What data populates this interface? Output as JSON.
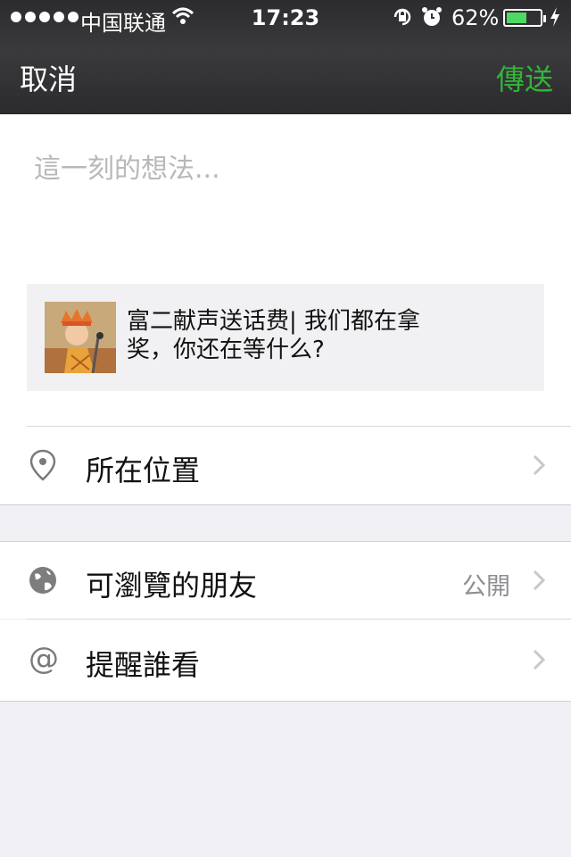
{
  "status_bar": {
    "carrier": "中国联通",
    "time": "17:23",
    "battery_percent": "62%",
    "battery_level": 0.62,
    "icons": [
      "signal-dots-icon",
      "wifi-icon",
      "rotation-lock-icon",
      "alarm-icon",
      "battery-icon",
      "charging-bolt-icon"
    ]
  },
  "nav": {
    "cancel_label": "取消",
    "send_label": "傳送",
    "send_color": "#34b43a"
  },
  "compose": {
    "placeholder": "這一刻的想法..."
  },
  "share_card": {
    "title": "富二献声送话费| 我们都在拿奖，你还在等什么?",
    "thumbnail_icon": "article-thumbnail"
  },
  "options": {
    "location": {
      "label": "所在位置",
      "icon": "location-pin-icon"
    },
    "visibility": {
      "label": "可瀏覽的朋友",
      "value": "公開",
      "icon": "globe-icon"
    },
    "mention": {
      "label": "提醒誰看",
      "icon": "at-sign-icon"
    }
  }
}
